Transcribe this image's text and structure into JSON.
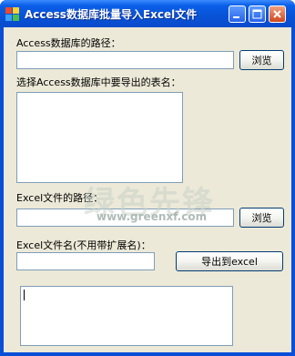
{
  "window": {
    "title": "Access数据库批量导入Excel文件",
    "icon": "app-icon"
  },
  "form": {
    "access_path_label": "Access数据库的路径：",
    "access_path_value": "",
    "browse_access_label": "浏览",
    "table_select_label": "选择Access数据库中要导出的表名：",
    "tables": [],
    "excel_path_label": "Excel文件的路径：",
    "excel_path_value": "",
    "browse_excel_label": "浏览",
    "excel_name_label": "Excel文件名(不用带扩展名)：",
    "excel_name_value": "",
    "export_label": "导出到excel",
    "log_text": ""
  },
  "watermark": {
    "text": "绿色先锋",
    "url": "www.greenxf.com"
  },
  "colors": {
    "titlebar": "#0a52d8",
    "client_bg": "#ece9d8",
    "input_border": "#7f9db9",
    "close_button": "#d0481c"
  }
}
